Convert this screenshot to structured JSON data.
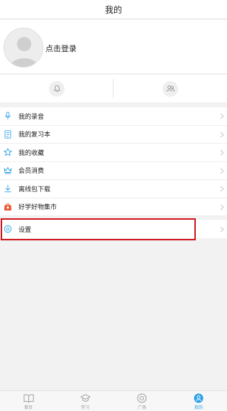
{
  "header": {
    "title": "我的"
  },
  "profile": {
    "login_label": "点击登录"
  },
  "icon_row": [
    {
      "icon": "bell-icon"
    },
    {
      "icon": "friends-icon"
    }
  ],
  "menu": {
    "items": [
      {
        "label": "我的录音",
        "icon": "microphone-icon"
      },
      {
        "label": "我的复习本",
        "icon": "notebook-icon"
      },
      {
        "label": "我的收藏",
        "icon": "star-icon"
      },
      {
        "label": "会员消费",
        "icon": "crown-icon"
      },
      {
        "label": "离线包下载",
        "icon": "download-icon"
      },
      {
        "label": "好学好物集市",
        "icon": "shopping-bag-icon"
      }
    ],
    "settings_label": "设置"
  },
  "tabbar": {
    "tabs": [
      {
        "label": "首页",
        "icon": "book-icon",
        "active": false
      },
      {
        "label": "学习",
        "icon": "graduation-cap-icon",
        "active": false
      },
      {
        "label": "广场",
        "icon": "compass-icon",
        "active": false
      },
      {
        "label": "我的",
        "icon": "user-icon",
        "active": true
      }
    ]
  },
  "colors": {
    "accent": "#2aa0e6",
    "highlight": "#d0111a",
    "shop": "#e8542e"
  }
}
